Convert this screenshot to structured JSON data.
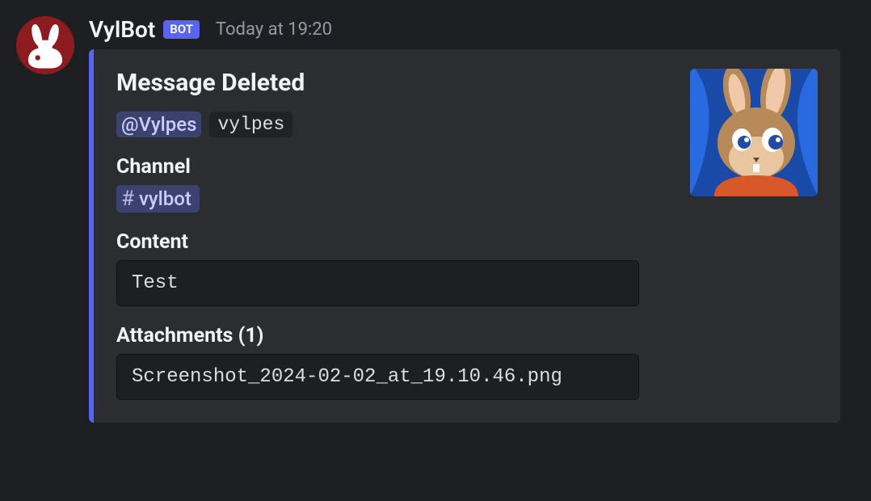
{
  "author": {
    "name": "VylBot",
    "badge": "BOT",
    "timestamp": "Today at 19:20"
  },
  "embed": {
    "title": "Message Deleted",
    "user_mention": "@Vylpes",
    "user_tag": "vylpes",
    "channel_label": "Channel",
    "channel_name": "vylbot",
    "content_label": "Content",
    "content_value": "Test",
    "attachments_label": "Attachments (1)",
    "attachments_value": "Screenshot_2024-02-02_at_19.10.46.png"
  }
}
